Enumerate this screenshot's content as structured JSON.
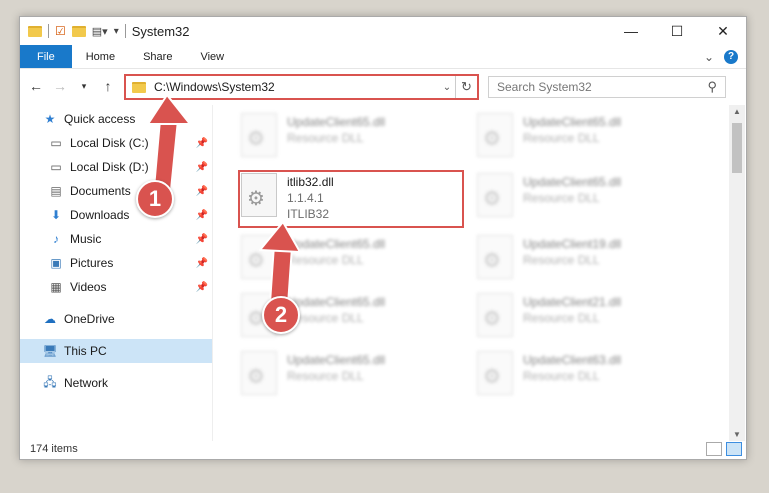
{
  "window": {
    "title": "System32",
    "controls": [
      "minimize-icon",
      "maximize-icon",
      "close-icon"
    ]
  },
  "ribbon": {
    "tabs": [
      "File",
      "Home",
      "Share",
      "View"
    ],
    "expand_glyph": "⌄",
    "help_glyph": "?"
  },
  "nav": {
    "address": "C:\\Windows\\System32",
    "search_placeholder": "Search System32"
  },
  "sidebar": {
    "items": [
      {
        "label": "Quick access",
        "icon": "star-icon",
        "pinned": false
      },
      {
        "label": "Local Disk (C:)",
        "icon": "drive-icon",
        "pinned": true
      },
      {
        "label": "Local Disk (D:)",
        "icon": "drive-icon",
        "pinned": true
      },
      {
        "label": "Documents",
        "icon": "documents-icon",
        "pinned": true
      },
      {
        "label": "Downloads",
        "icon": "download-icon",
        "pinned": true
      },
      {
        "label": "Music",
        "icon": "music-icon",
        "pinned": true
      },
      {
        "label": "Pictures",
        "icon": "pictures-icon",
        "pinned": true
      },
      {
        "label": "Videos",
        "icon": "videos-icon",
        "pinned": true
      },
      {
        "label": "OneDrive",
        "icon": "cloud-icon",
        "pinned": false
      },
      {
        "label": "This PC",
        "icon": "computer-icon",
        "pinned": false,
        "selected": true
      },
      {
        "label": "Network",
        "icon": "network-icon",
        "pinned": false
      }
    ]
  },
  "files": {
    "selected": {
      "name": "itlib32.dll",
      "version": "1.1.4.1",
      "description": "ITLIB32"
    },
    "background": [
      {
        "name": "UpdateClient65.dll",
        "desc": "Resource DLL"
      },
      {
        "name": "UpdateClient65.dll",
        "desc": "Resource DLL"
      },
      {
        "name": "UpdateClient65.dll",
        "desc": "Resource DLL"
      },
      {
        "name": "UpdateClient65.dll",
        "desc": "Resource DLL"
      },
      {
        "name": "UpdateClient19.dll",
        "desc": "Resource DLL"
      },
      {
        "name": "UpdateClient65.dll",
        "desc": "Resource DLL"
      },
      {
        "name": "UpdateClient21.dll",
        "desc": "Resource DLL"
      },
      {
        "name": "UpdateClient65.dll",
        "desc": "Resource DLL"
      },
      {
        "name": "UpdateClient63.dll",
        "desc": "Resource DLL"
      }
    ]
  },
  "status": {
    "items": "174 items"
  },
  "annotations": {
    "step1": "1",
    "step2": "2",
    "color": "#d9534f"
  }
}
